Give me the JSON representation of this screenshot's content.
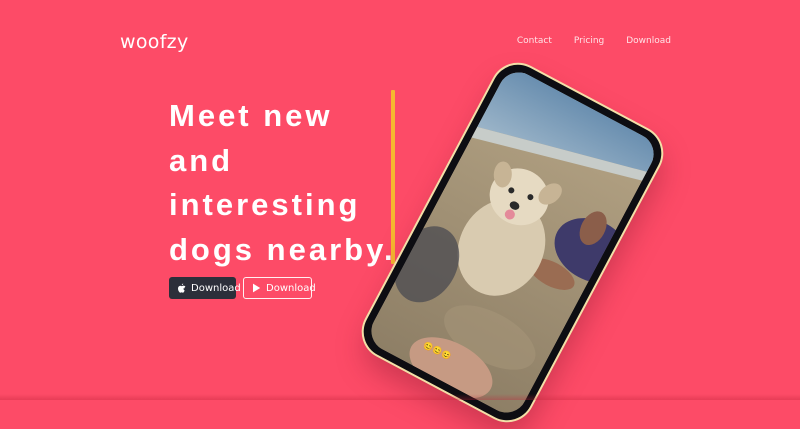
{
  "brand": {
    "name": "woofzy"
  },
  "nav": {
    "items": [
      "Contact",
      "Pricing",
      "Download"
    ]
  },
  "hero": {
    "lines": [
      "Meet new",
      "and",
      "interesting",
      "dogs nearby."
    ]
  },
  "buttons": {
    "apple": {
      "label": "Download",
      "icon": "apple-icon"
    },
    "play": {
      "label": "Download",
      "icon": "play-store-icon"
    }
  },
  "phone": {
    "reactions": "😊😊😊"
  },
  "colors": {
    "background": "#fd4b67",
    "accent_bar": "#f5b730",
    "dark_button": "#2c2f3a"
  }
}
